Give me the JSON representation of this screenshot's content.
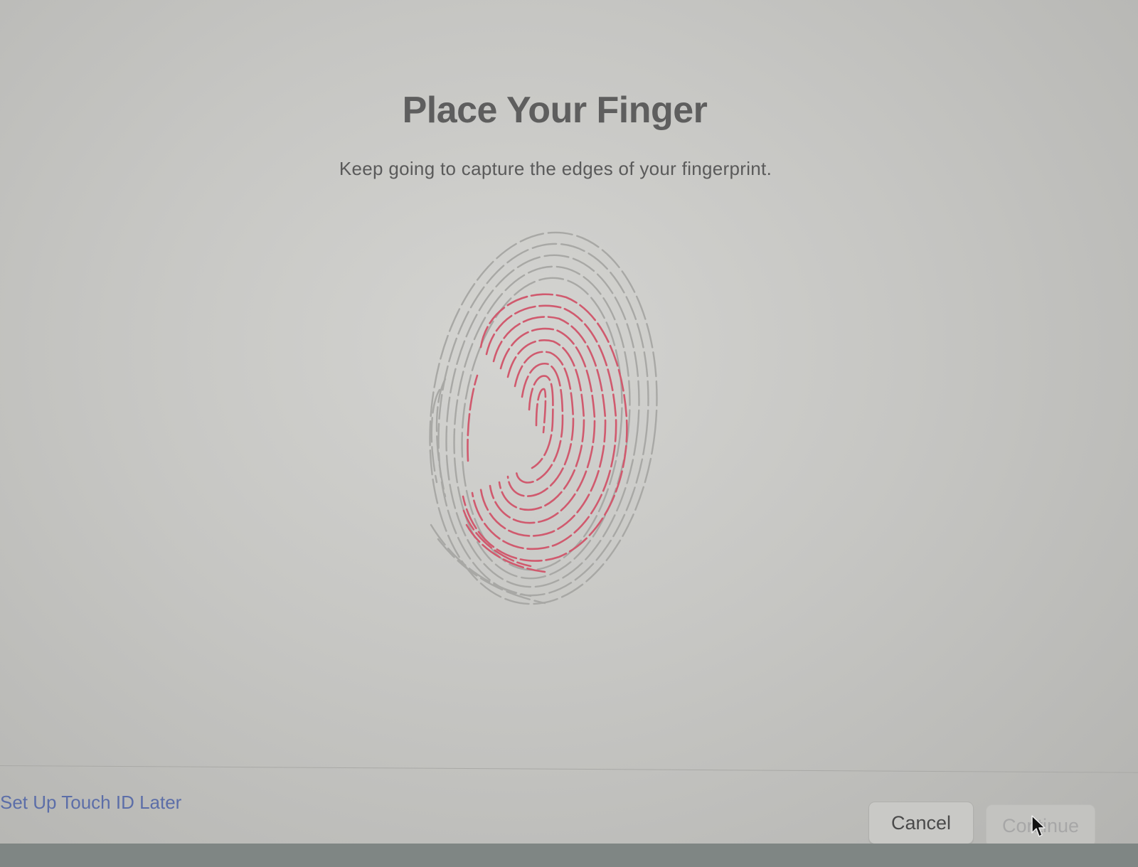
{
  "dialog": {
    "title": "Place Your Finger",
    "subtitle": "Keep going to capture the edges of your fingerprint."
  },
  "fingerprint": {
    "icon": "fingerprint-icon",
    "captured_color": "#d05a6e",
    "uncaptured_color": "#a8a8a5"
  },
  "footer": {
    "later_link": "Set Up Touch ID Later",
    "cancel_label": "Cancel",
    "continue_label": "Continue",
    "continue_enabled": false
  },
  "colors": {
    "link": "#5c6ea8",
    "accent_pink": "#d05a6e"
  }
}
